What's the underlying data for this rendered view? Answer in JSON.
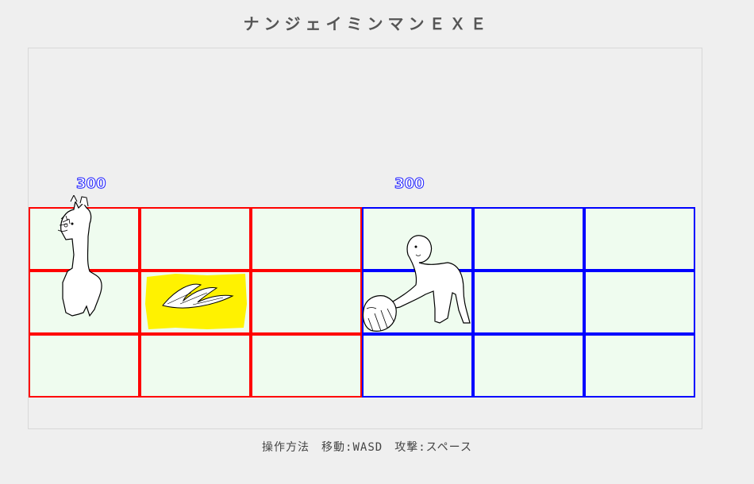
{
  "title": "ナンジェイミンマンＥＸＥ",
  "player": {
    "hp": "300",
    "sprite": "alpaca-icon"
  },
  "enemy": {
    "hp": "300",
    "sprite": "stick-figure-with-shovel-icon"
  },
  "projectile": {
    "sprite": "feather-blade-icon",
    "highlight_color": "#fff200"
  },
  "grid": {
    "player_side_color": "#ff0000",
    "enemy_side_color": "#0000ff",
    "cell_fill": "#effcef",
    "columns_per_side": 3,
    "rows": 3
  },
  "controls": "操作方法　移動:WASD　攻撃:スペース"
}
